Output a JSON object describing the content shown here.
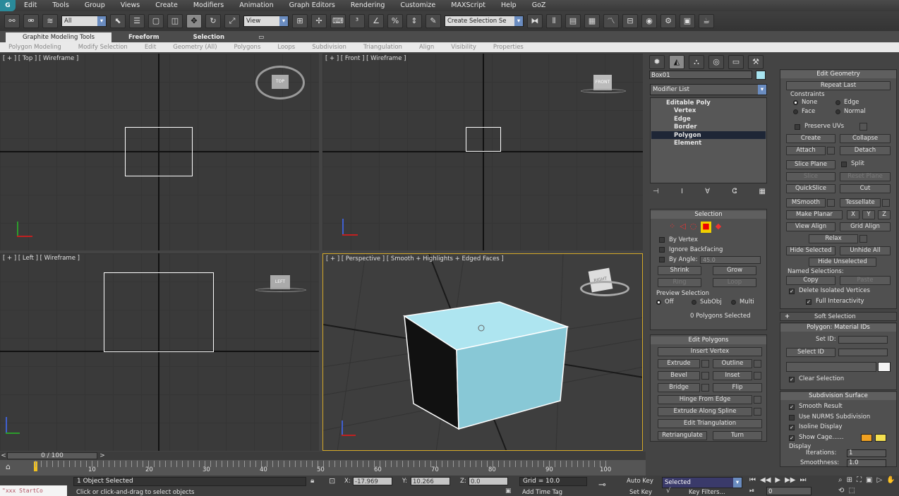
{
  "menu": [
    "Edit",
    "Tools",
    "Group",
    "Views",
    "Create",
    "Modifiers",
    "Animation",
    "Graph Editors",
    "Rendering",
    "Customize",
    "MAXScript",
    "Help",
    "GoZ"
  ],
  "toolbar": {
    "filter": "All",
    "refcoord": "View",
    "named_sel": "Create Selection Se"
  },
  "ribbon": {
    "tabs": [
      "Graphite Modeling Tools",
      "Freeform",
      "Selection"
    ],
    "subtabs": [
      "Polygon Modeling",
      "Modify Selection",
      "Edit",
      "Geometry (All)",
      "Polygons",
      "Loops",
      "Subdivision",
      "Triangulation",
      "Align",
      "Visibility",
      "Properties"
    ]
  },
  "viewports": {
    "top": "[ + ] [ Top ] [ Wireframe ]",
    "front": "[ + ] [ Front ] [ Wireframe ]",
    "left": "[ + ] [ Left ] [ Wireframe ]",
    "persp": "[ + ] [ Perspective ] [ Smooth + Highlights + Edged Faces ]",
    "cube_top": "TOP",
    "cube_front": "FRONT",
    "cube_left": "LEFT",
    "cube_persp": "RIGHT"
  },
  "cmd": {
    "obj_name": "Box01",
    "modlist": "Modifier List",
    "stack": [
      "Editable Poly",
      "Vertex",
      "Edge",
      "Border",
      "Polygon",
      "Element"
    ],
    "selection": {
      "title": "Selection",
      "by_vertex": "By Vertex",
      "ignore_bf": "Ignore Backfacing",
      "by_angle": "By Angle:",
      "angle_val": "45.0",
      "shrink": "Shrink",
      "grow": "Grow",
      "ring": "Ring",
      "loop": "Loop",
      "preview": "Preview Selection",
      "off": "Off",
      "subobj": "SubObj",
      "multi": "Multi",
      "count": "0 Polygons Selected"
    },
    "edit_polys": {
      "title": "Edit Polygons",
      "insert_vertex": "Insert Vertex",
      "extrude": "Extrude",
      "outline": "Outline",
      "bevel": "Bevel",
      "inset": "Inset",
      "bridge": "Bridge",
      "flip": "Flip",
      "hinge": "Hinge From Edge",
      "extrude_spline": "Extrude Along Spline",
      "edit_tri": "Edit Triangulation",
      "retri": "Retriangulate",
      "turn": "Turn"
    },
    "edit_geom": {
      "title": "Edit Geometry",
      "repeat": "Repeat Last",
      "constraints": "Constraints",
      "none": "None",
      "edge": "Edge",
      "face": "Face",
      "normal": "Normal",
      "preserve": "Preserve UVs",
      "create": "Create",
      "collapse": "Collapse",
      "attach": "Attach",
      "detach": "Detach",
      "slice_plane": "Slice Plane",
      "split": "Split",
      "slice": "Slice",
      "reset_plane": "Reset Plane",
      "quickslice": "QuickSlice",
      "cut": "Cut",
      "msmooth": "MSmooth",
      "tessellate": "Tessellate",
      "make_planar": "Make Planar",
      "x": "X",
      "y": "Y",
      "z": "Z",
      "view_align": "View Align",
      "grid_align": "Grid Align",
      "relax": "Relax",
      "hide_sel": "Hide Selected",
      "unhide": "Unhide All",
      "hide_unsel": "Hide Unselected",
      "named": "Named Selections:",
      "copy": "Copy",
      "paste": "Paste",
      "delete_iso": "Delete Isolated Vertices",
      "full_inter": "Full Interactivity"
    },
    "soft": "Soft Selection",
    "matid": {
      "title": "Polygon: Material IDs",
      "set_id": "Set ID:",
      "select_id": "Select ID",
      "clear": "Clear Selection"
    },
    "subdiv": {
      "title": "Subdivision Surface",
      "smooth_result": "Smooth Result",
      "nurms": "Use NURMS Subdivision",
      "isoline": "Isoline Display",
      "show_cage": "Show Cage......",
      "display": "Display",
      "iterations": "Iterations:",
      "iter_val": "1",
      "smoothness": "Smoothness:",
      "smooth_val": "1.0"
    }
  },
  "timeline": {
    "frame": "0 / 100",
    "ticks": [
      "10",
      "20",
      "30",
      "40",
      "50",
      "60",
      "70",
      "80",
      "90",
      "100"
    ]
  },
  "status": {
    "script": "\"xxx StartCo",
    "selected": "1 Object Selected",
    "prompt": "Click or click-and-drag to select objects",
    "x_lbl": "X:",
    "x": "-17.969",
    "y_lbl": "Y:",
    "y": "10.266",
    "z_lbl": "Z:",
    "z": "0.0",
    "grid": "Grid = 10.0",
    "addtag": "Add Time Tag",
    "autokey": "Auto Key",
    "setkey": "Set Key",
    "keysel": "Selected",
    "keyfilters": "Key Filters...",
    "frame": "0"
  },
  "colors": {
    "box": "#a8e4f0",
    "accent": "#e0a020"
  }
}
